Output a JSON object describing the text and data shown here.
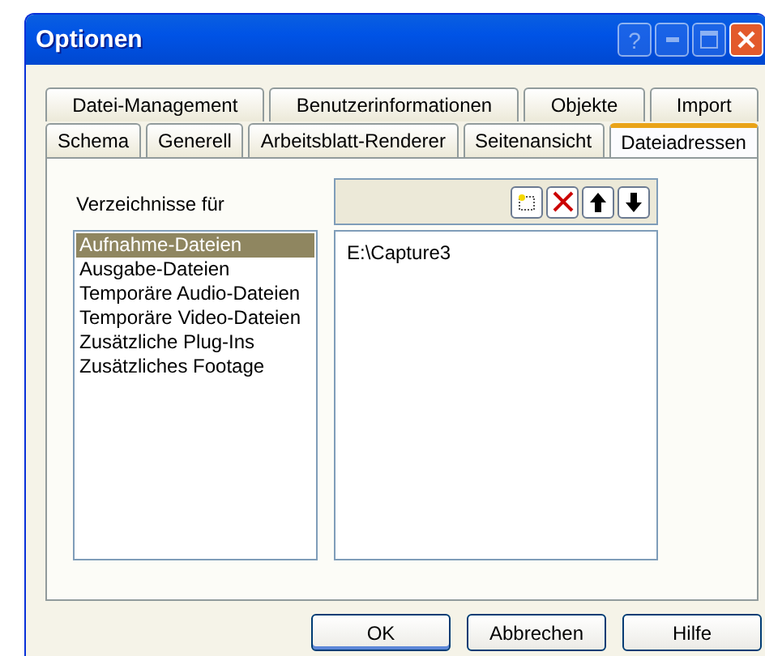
{
  "window": {
    "title": "Optionen",
    "help_button": "?"
  },
  "tabs": [
    [
      {
        "label": "Datei-Management",
        "selected": false
      },
      {
        "label": "Benutzerinformationen",
        "selected": false
      },
      {
        "label": "Objekte",
        "selected": false
      },
      {
        "label": "Import",
        "selected": false
      }
    ],
    [
      {
        "label": "Schema",
        "selected": false
      },
      {
        "label": "Generell",
        "selected": false
      },
      {
        "label": "Arbeitsblatt-Renderer",
        "selected": false
      },
      {
        "label": "Seitenansicht",
        "selected": false
      },
      {
        "label": "Dateiadressen",
        "selected": true
      }
    ]
  ],
  "directories_label": "Verzeichnisse für",
  "categories": [
    {
      "label": "Aufnahme-Dateien",
      "selected": true
    },
    {
      "label": "Ausgabe-Dateien",
      "selected": false
    },
    {
      "label": "Temporäre Audio-Dateien",
      "selected": false
    },
    {
      "label": "Temporäre Video-Dateien",
      "selected": false
    },
    {
      "label": "Zusätzliche Plug-Ins",
      "selected": false
    },
    {
      "label": "Zusätzliches Footage",
      "selected": false
    }
  ],
  "paths": [
    "E:\\Capture3"
  ],
  "buttons": [
    {
      "label": "OK",
      "default": true
    },
    {
      "label": "Abbrechen",
      "default": false
    },
    {
      "label": "Hilfe",
      "default": false
    }
  ]
}
